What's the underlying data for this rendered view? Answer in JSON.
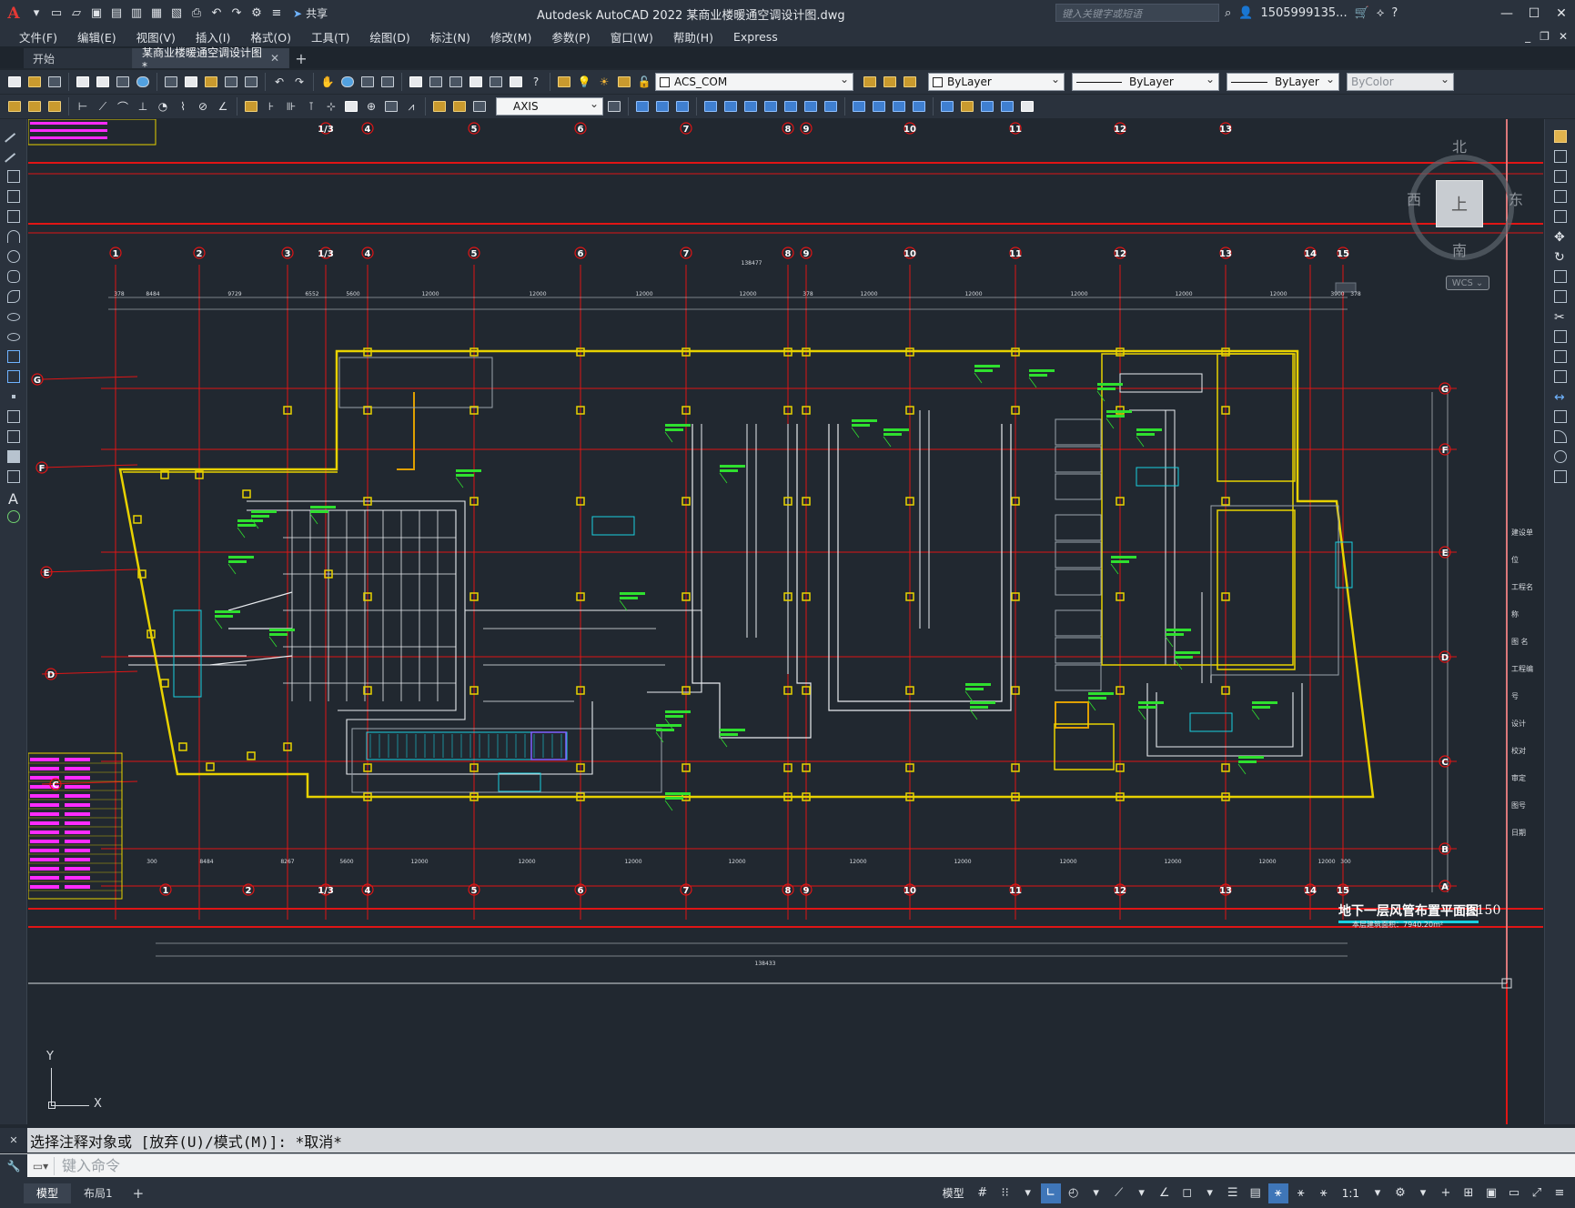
{
  "app": {
    "logo": "A",
    "title": "Autodesk AutoCAD 2022    某商业楼暖通空调设计图.dwg",
    "share_label": "共享",
    "search_placeholder": "键入关键字或短语",
    "user": "1505999135...",
    "help_label": "?"
  },
  "menu": [
    "文件(F)",
    "编辑(E)",
    "视图(V)",
    "插入(I)",
    "格式(O)",
    "工具(T)",
    "绘图(D)",
    "标注(N)",
    "修改(M)",
    "参数(P)",
    "窗口(W)",
    "帮助(H)",
    "Express"
  ],
  "file_tabs": {
    "start": "开始",
    "active": "某商业楼暖通空调设计图*",
    "add": "+"
  },
  "toolbar": {
    "layer_combo": "ACS_COM",
    "color_combo": "ByLayer",
    "linetype_combo": "ByLayer",
    "lineweight_combo": "ByLayer",
    "plotstyle_combo": "ByColor",
    "dimstyle_combo": "AXIS"
  },
  "viewcube": {
    "north": "北",
    "south": "南",
    "east": "东",
    "west": "西",
    "top": "上",
    "wcs": "WCS"
  },
  "drawing": {
    "plan_title": "地下一层风管布置平面图",
    "scale": "1:150",
    "area_note": "本层建筑面积：7940.20m²",
    "axes_top": [
      "1",
      "2",
      "3",
      "1/3",
      "4",
      "5",
      "6",
      "7",
      "8",
      "9",
      "10",
      "11",
      "12",
      "13",
      "14",
      "15"
    ],
    "axes_bottom": [
      "1",
      "2",
      "1/3",
      "4",
      "5",
      "6",
      "7",
      "8",
      "9",
      "10",
      "11",
      "12",
      "13",
      "14",
      "15"
    ],
    "axes_upper_row": [
      "1/3",
      "4",
      "5",
      "6",
      "7",
      "8",
      "9",
      "10",
      "11",
      "12",
      "13"
    ],
    "axes_rows": [
      "G",
      "F",
      "E",
      "D",
      "C",
      "B",
      "A"
    ],
    "axes_rows_left": [
      "G",
      "F",
      "E",
      "D",
      "C"
    ],
    "dim_top": [
      "378",
      "8484",
      "9729",
      "6552",
      "5600",
      "12000",
      "12000",
      "12000",
      "12000",
      "378",
      "12000",
      "12000",
      "12000",
      "12000",
      "12000",
      "3900",
      "378"
    ],
    "dim_bottom": [
      "300",
      "8484",
      "8267",
      "5600",
      "12000",
      "12000",
      "12000",
      "12000",
      "12000",
      "12000",
      "12000",
      "12000",
      "12000",
      "12000",
      "300"
    ],
    "overall_dim_top": "138477",
    "overall_dim_bottom": "138433",
    "title_block_labels": [
      "建设单位",
      "工程名称",
      "图 名",
      "工程编号",
      "设计",
      "校对",
      "审定",
      "图号",
      "日期"
    ],
    "ucs_x": "X",
    "ucs_y": "Y"
  },
  "command": {
    "history": "选择注释对象或 [放弃(U)/模式(M)]: *取消*",
    "placeholder": "键入命令"
  },
  "status": {
    "tabs": [
      "模型",
      "布局1"
    ],
    "add": "+",
    "model_label": "模型",
    "scale": "1:1"
  },
  "colors": {
    "red_grid": "#e01515",
    "yellow_wall": "#e8d200",
    "green_text": "#2fe02f",
    "cyan": "#19d0e0",
    "magenta": "#ff2bff",
    "background": "#212830"
  }
}
